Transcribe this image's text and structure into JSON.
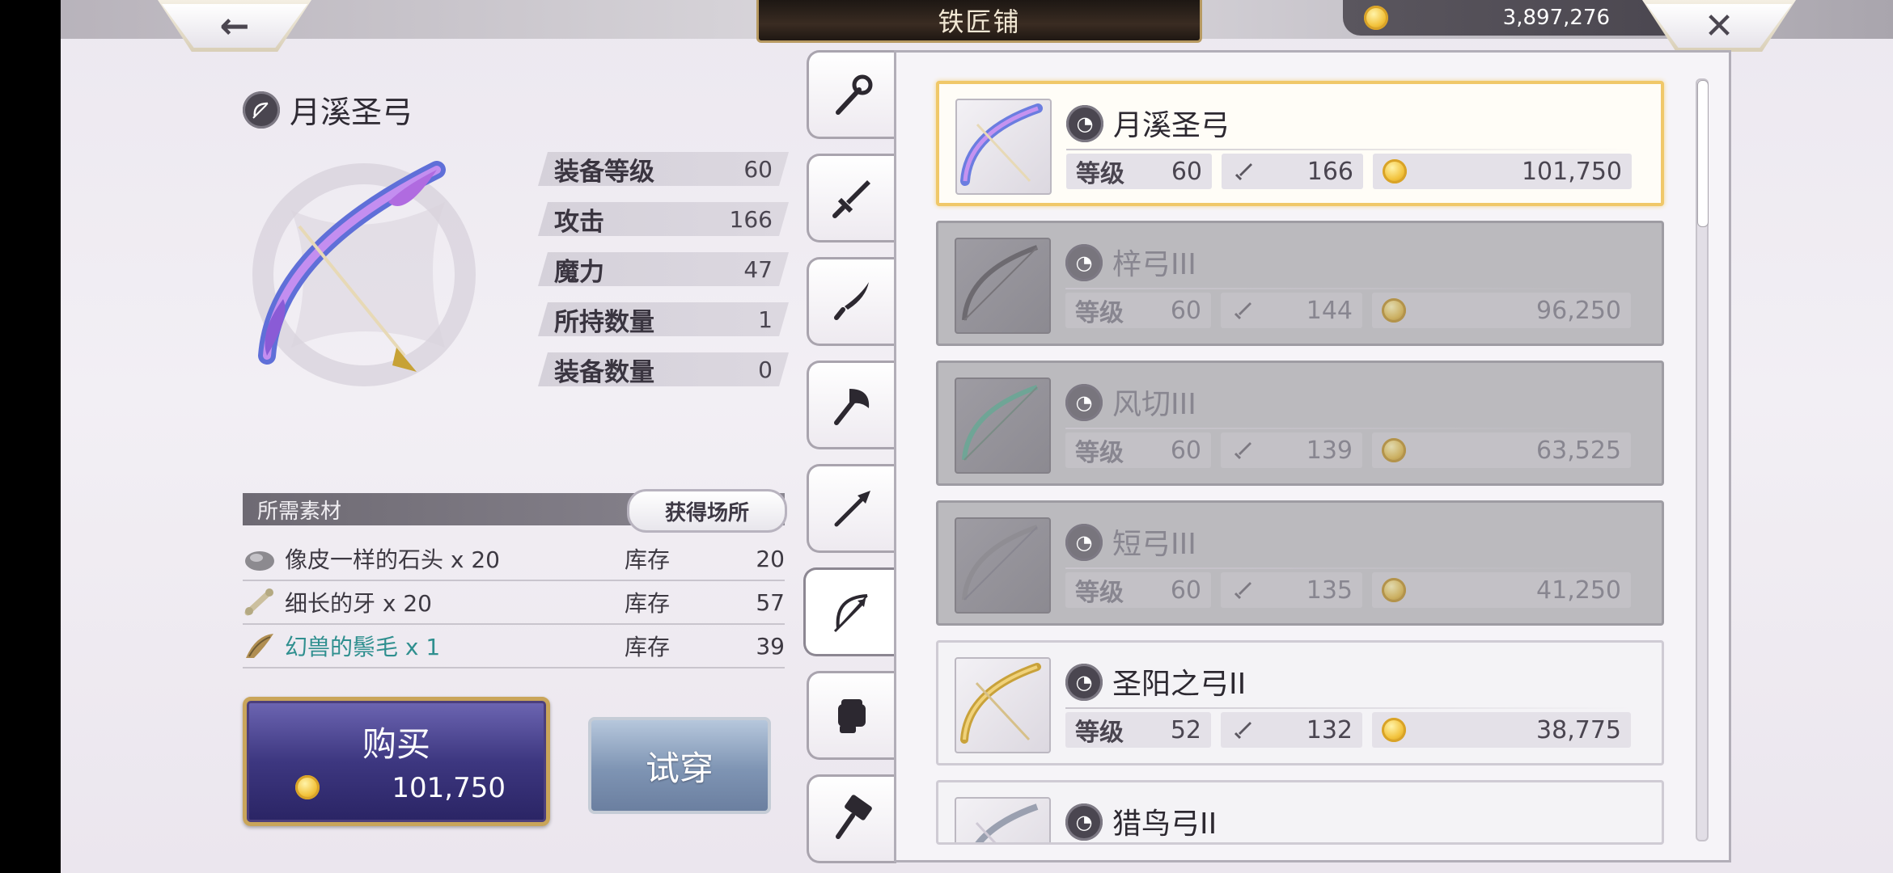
{
  "header": {
    "title": "铁匠铺",
    "gold": "3,897,276",
    "back_icon": "←",
    "close_icon": "✕"
  },
  "detail": {
    "name": "月溪圣弓",
    "stats": [
      {
        "label": "装备等级",
        "value": "60"
      },
      {
        "label": "攻击",
        "value": "166"
      },
      {
        "label": "魔力",
        "value": "47"
      },
      {
        "label": "所持数量",
        "value": "1"
      },
      {
        "label": "装备数量",
        "value": "0"
      }
    ]
  },
  "materials": {
    "header": "所需素材",
    "obtain_button": "获得场所",
    "items": [
      {
        "name": "像皮一样的石头 x 20",
        "stock_label": "库存",
        "count": "20"
      },
      {
        "name": "细长的牙 x 20",
        "stock_label": "库存",
        "count": "57"
      },
      {
        "name": "幻兽的鬃毛 x 1",
        "stock_label": "库存",
        "count": "39"
      }
    ]
  },
  "actions": {
    "buy_label": "购买",
    "buy_price": "101,750",
    "try_label": "试穿"
  },
  "tabs": [
    "staff-icon",
    "sword-icon",
    "machete-icon",
    "axe-icon",
    "spear-icon",
    "bow-icon",
    "gauntlet-icon",
    "hammer-icon"
  ],
  "list": {
    "level_label": "等级",
    "items": [
      {
        "name": "月溪圣弓",
        "level": "60",
        "attack": "166",
        "price": "101,750"
      },
      {
        "name": "梓弓III",
        "level": "60",
        "attack": "144",
        "price": "96,250"
      },
      {
        "name": "风切III",
        "level": "60",
        "attack": "139",
        "price": "63,525"
      },
      {
        "name": "短弓III",
        "level": "60",
        "attack": "135",
        "price": "41,250"
      },
      {
        "name": "圣阳之弓II",
        "level": "52",
        "attack": "132",
        "price": "38,775"
      },
      {
        "name": "猎鸟弓II"
      }
    ]
  }
}
